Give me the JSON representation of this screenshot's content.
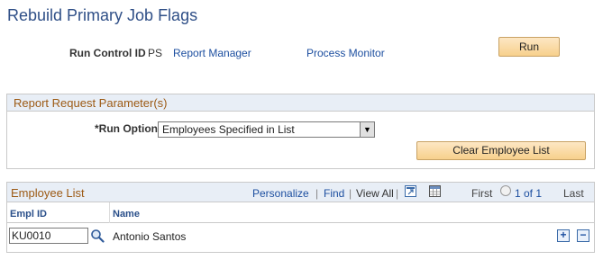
{
  "page": {
    "title": "Rebuild Primary Job Flags"
  },
  "run_control": {
    "label": "Run Control ID",
    "value": "PS",
    "report_manager": "Report Manager",
    "process_monitor": "Process Monitor",
    "run_button": "Run"
  },
  "parameters": {
    "header": "Report Request Parameter(s)",
    "run_option_label": "*Run Option",
    "run_option_value": "Employees Specified in List",
    "clear_button": "Clear Employee List"
  },
  "employee_list": {
    "title": "Employee List",
    "personalize": "Personalize",
    "find": "Find",
    "view_all": "View All",
    "separator": "|",
    "first": "First",
    "count": "1 of 1",
    "last": "Last",
    "columns": [
      "Empl ID",
      "Name"
    ],
    "rows": [
      {
        "empl_id": "KU0010",
        "name": "Antonio Santos"
      }
    ],
    "add_symbol": "+",
    "delete_symbol": "−"
  },
  "colors": {
    "title": "#2f4f87",
    "link": "#1d4fa0",
    "group_header_text": "#9c5a15",
    "button_bg": "#f7d08c"
  }
}
